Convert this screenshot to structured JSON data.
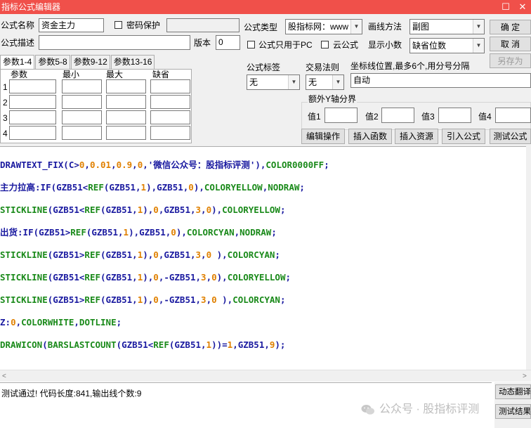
{
  "window": {
    "title": "指标公式编辑器",
    "max_btn": "☐",
    "close_btn": "✕"
  },
  "form": {
    "name_label": "公式名称",
    "name_value": "资金主力",
    "password_label": "密码保护",
    "desc_label": "公式描述",
    "version_label": "版本",
    "version_value": "0",
    "type_label": "公式类型",
    "type_value": "股指标网：www",
    "draw_method_label": "画线方法",
    "draw_method_value": "副图",
    "pc_only_label": "公式只用于PC",
    "cloud_label": "云公式",
    "decimals_label": "显示小数",
    "decimals_value": "缺省位数",
    "ok_button": "确 定",
    "cancel_button": "取 消",
    "saveas_button": "另存为"
  },
  "tabs": [
    "参数1-4",
    "参数5-8",
    "参数9-12",
    "参数13-16"
  ],
  "params": {
    "headers": [
      "参数",
      "最小",
      "最大",
      "缺省"
    ],
    "rows": [
      "1",
      "2",
      "3",
      "4"
    ]
  },
  "tags": {
    "formula_tag_label": "公式标签",
    "formula_tag_value": "无",
    "trade_rule_label": "交易法则",
    "trade_rule_value": "无",
    "axis_pos_label": "坐标线位置,最多6个,用分号分隔",
    "axis_pos_value": "自动",
    "extra_axis_label": "额外Y轴分界",
    "val_labels": [
      "值1",
      "值2",
      "值3",
      "值4"
    ]
  },
  "actions": [
    "编辑操作",
    "插入函数",
    "插入资源",
    "引入公式",
    "测试公式"
  ],
  "code_lines": [
    [
      [
        "DRAWTEXT_FIX(C>",
        "#1a1aa0"
      ],
      [
        "0",
        "#e08000"
      ],
      [
        ",",
        "#1a1aa0"
      ],
      [
        "0.01",
        "#e08000"
      ],
      [
        ",",
        "#1a1aa0"
      ],
      [
        "0.9",
        "#e08000"
      ],
      [
        ",",
        "#1a1aa0"
      ],
      [
        "0",
        "#e08000"
      ],
      [
        ",'",
        "#1a1aa0"
      ],
      [
        "微信公众号：股指标评测",
        "#1a1aa0"
      ],
      [
        "'),",
        "#1a1aa0"
      ],
      [
        "COLOR0000FF",
        "#1a8a1a"
      ],
      [
        ";",
        "#1a1aa0"
      ]
    ],
    [
      [
        "主力拉高",
        "#1a1aa0"
      ],
      [
        ":IF(GZB51<",
        "#1a1aa0"
      ],
      [
        "REF",
        "#1a8a1a"
      ],
      [
        "(GZB51,",
        "#1a1aa0"
      ],
      [
        "1",
        "#e08000"
      ],
      [
        "),GZB51,",
        "#1a1aa0"
      ],
      [
        "0",
        "#e08000"
      ],
      [
        "),",
        "#1a1aa0"
      ],
      [
        "COLORYELLOW",
        "#1a8a1a"
      ],
      [
        ",",
        "#1a1aa0"
      ],
      [
        "NODRAW",
        "#1a8a1a"
      ],
      [
        ";",
        "#1a1aa0"
      ]
    ],
    [
      [
        "STICKLINE",
        "#1a8a1a"
      ],
      [
        "(GZB51<",
        "#1a1aa0"
      ],
      [
        "REF",
        "#1a8a1a"
      ],
      [
        "(GZB51,",
        "#1a1aa0"
      ],
      [
        "1",
        "#e08000"
      ],
      [
        "),",
        "#1a1aa0"
      ],
      [
        "0",
        "#e08000"
      ],
      [
        ",GZB51,",
        "#1a1aa0"
      ],
      [
        "3",
        "#e08000"
      ],
      [
        ",",
        "#1a1aa0"
      ],
      [
        "0",
        "#e08000"
      ],
      [
        "),",
        "#1a1aa0"
      ],
      [
        "COLORYELLOW",
        "#1a8a1a"
      ],
      [
        ";",
        "#1a1aa0"
      ]
    ],
    [
      [
        "出货",
        "#1a1aa0"
      ],
      [
        ":IF(GZB51>",
        "#1a1aa0"
      ],
      [
        "REF",
        "#1a8a1a"
      ],
      [
        "(GZB51,",
        "#1a1aa0"
      ],
      [
        "1",
        "#e08000"
      ],
      [
        "),GZB51,",
        "#1a1aa0"
      ],
      [
        "0",
        "#e08000"
      ],
      [
        "),",
        "#1a1aa0"
      ],
      [
        "COLORCYAN",
        "#1a8a1a"
      ],
      [
        ",",
        "#1a1aa0"
      ],
      [
        "NODRAW",
        "#1a8a1a"
      ],
      [
        ";",
        "#1a1aa0"
      ]
    ],
    [
      [
        "STICKLINE",
        "#1a8a1a"
      ],
      [
        "(GZB51>",
        "#1a1aa0"
      ],
      [
        "REF",
        "#1a8a1a"
      ],
      [
        "(GZB51,",
        "#1a1aa0"
      ],
      [
        "1",
        "#e08000"
      ],
      [
        "),",
        "#1a1aa0"
      ],
      [
        "0",
        "#e08000"
      ],
      [
        ",GZB51,",
        "#1a1aa0"
      ],
      [
        "3",
        "#e08000"
      ],
      [
        ",",
        "#1a1aa0"
      ],
      [
        "0",
        "#e08000"
      ],
      [
        " ),",
        "#1a1aa0"
      ],
      [
        "COLORCYAN",
        "#1a8a1a"
      ],
      [
        ";",
        "#1a1aa0"
      ]
    ],
    [
      [
        "STICKLINE",
        "#1a8a1a"
      ],
      [
        "(GZB51<",
        "#1a1aa0"
      ],
      [
        "REF",
        "#1a8a1a"
      ],
      [
        "(GZB51,",
        "#1a1aa0"
      ],
      [
        "1",
        "#e08000"
      ],
      [
        "),",
        "#1a1aa0"
      ],
      [
        "0",
        "#e08000"
      ],
      [
        ",-GZB51,",
        "#1a1aa0"
      ],
      [
        "3",
        "#e08000"
      ],
      [
        ",",
        "#1a1aa0"
      ],
      [
        "0",
        "#e08000"
      ],
      [
        "),",
        "#1a1aa0"
      ],
      [
        "COLORYELLOW",
        "#1a8a1a"
      ],
      [
        ";",
        "#1a1aa0"
      ]
    ],
    [
      [
        "STICKLINE",
        "#1a8a1a"
      ],
      [
        "(GZB51>",
        "#1a1aa0"
      ],
      [
        "REF",
        "#1a8a1a"
      ],
      [
        "(GZB51,",
        "#1a1aa0"
      ],
      [
        "1",
        "#e08000"
      ],
      [
        "),",
        "#1a1aa0"
      ],
      [
        "0",
        "#e08000"
      ],
      [
        ",-GZB51,",
        "#1a1aa0"
      ],
      [
        "3",
        "#e08000"
      ],
      [
        ",",
        "#1a1aa0"
      ],
      [
        "0",
        "#e08000"
      ],
      [
        " ),",
        "#1a1aa0"
      ],
      [
        "COLORCYAN",
        "#1a8a1a"
      ],
      [
        ";",
        "#1a1aa0"
      ]
    ],
    [
      [
        "Z:",
        "#1a1aa0"
      ],
      [
        "0",
        "#e08000"
      ],
      [
        ",",
        "#1a1aa0"
      ],
      [
        "COLORWHITE",
        "#1a8a1a"
      ],
      [
        ",",
        "#1a1aa0"
      ],
      [
        "DOTLINE",
        "#1a8a1a"
      ],
      [
        ";",
        "#1a1aa0"
      ]
    ],
    [
      [
        "DRAWICON",
        "#1a8a1a"
      ],
      [
        "(",
        "#1a1aa0"
      ],
      [
        "BARSLASTCOUNT",
        "#1a8a1a"
      ],
      [
        "(GZB51<",
        "#1a1aa0"
      ],
      [
        "REF",
        "#1a8a1a"
      ],
      [
        "(GZB51,",
        "#1a1aa0"
      ],
      [
        "1",
        "#e08000"
      ],
      [
        "))=",
        "#1a1aa0"
      ],
      [
        "1",
        "#e08000"
      ],
      [
        ",GZB51,",
        "#1a1aa0"
      ],
      [
        "9",
        "#e08000"
      ],
      [
        ");",
        "#1a1aa0"
      ]
    ]
  ],
  "status_text": "测试通过! 代码长度:841,输出线个数:9",
  "right_panel": {
    "translate_btn": "动态翻译",
    "test_result_btn": "测试结果"
  },
  "watermark": "公众号 · 股指标评测",
  "colors": {
    "titlebar": "#f0504a",
    "keyword": "#1a8a1a",
    "number": "#e08000",
    "text": "#1a1aa0"
  }
}
